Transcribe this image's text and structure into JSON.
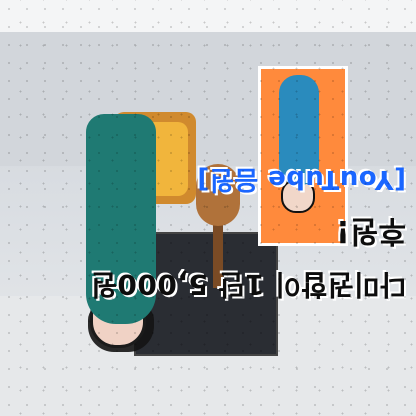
{
  "overlay": {
    "line1": "다미권합이 1단 5,000원",
    "line2": "후원!",
    "line3": "[YouTube 음원]"
  },
  "colors": {
    "accent_blue": "#1a66ff",
    "stroke_white": "#ffffff",
    "inset_orange": "#ff8a3c",
    "person_teal": "#1f7a73"
  },
  "icons": {
    "chat_icon": "speech-bubble-icon"
  }
}
